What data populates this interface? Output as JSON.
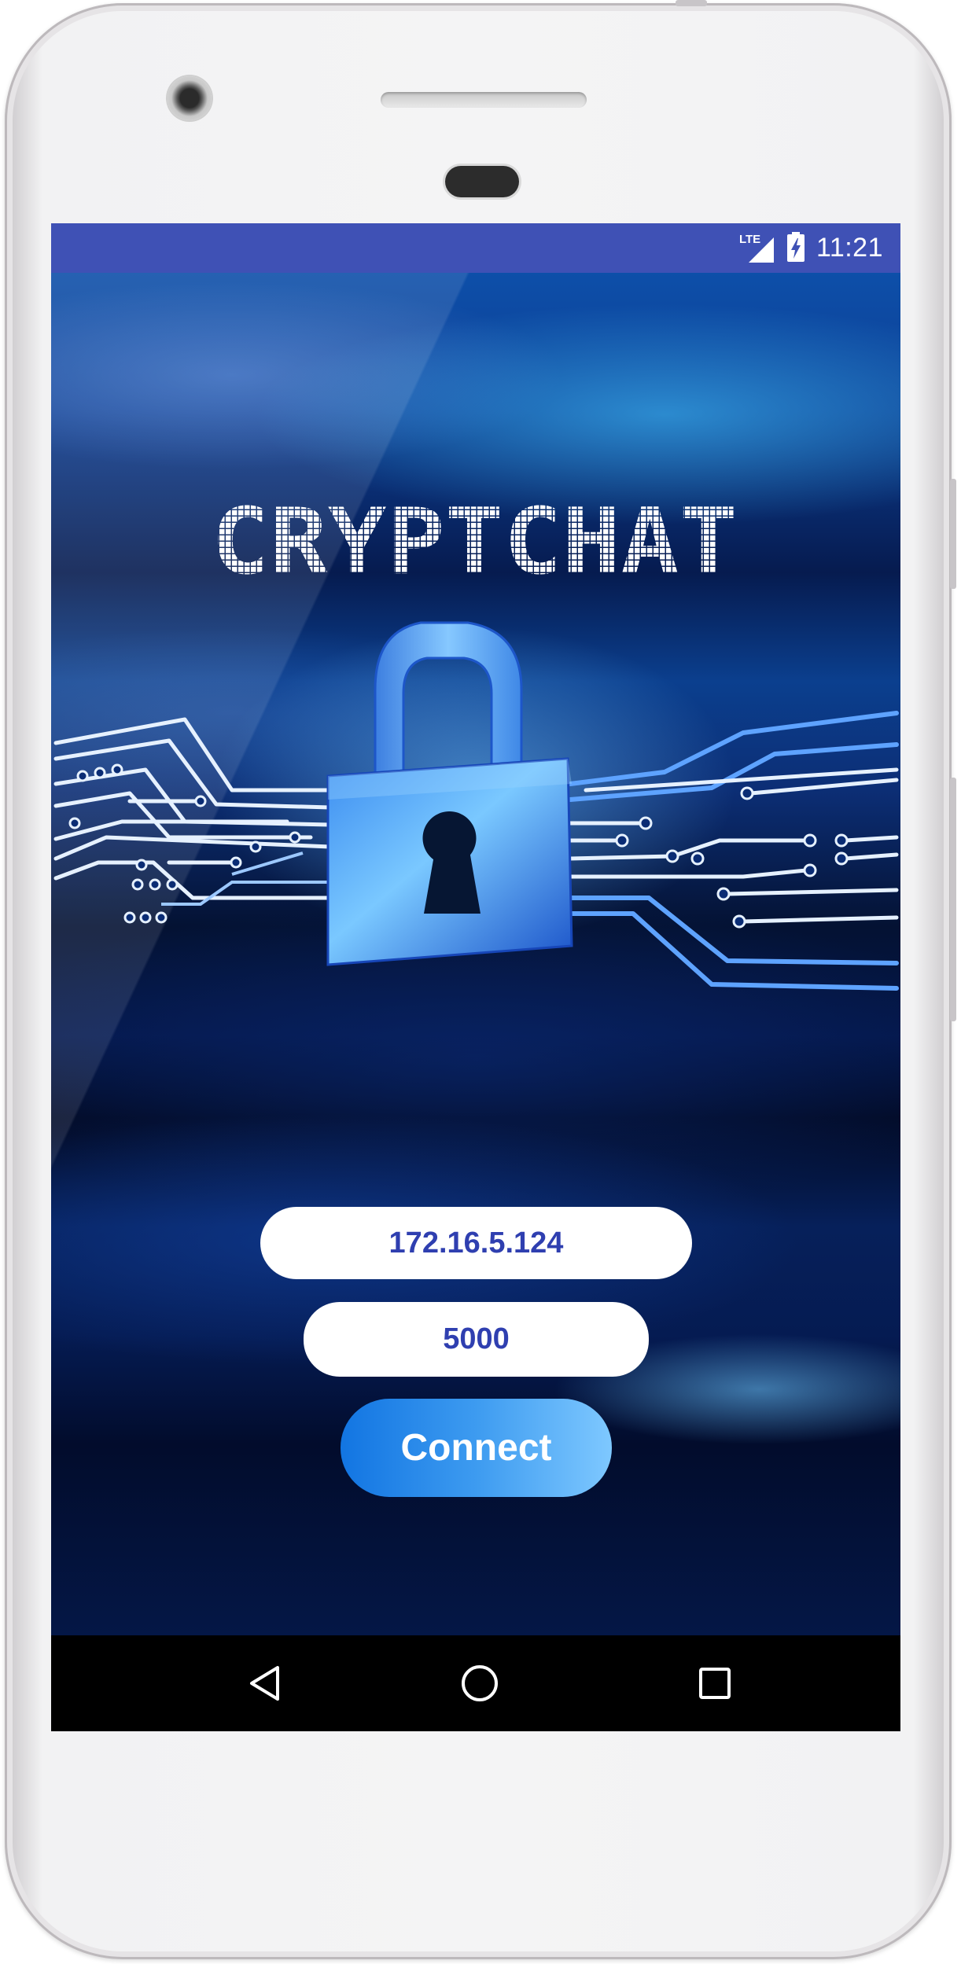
{
  "status_bar": {
    "network_label": "LTE",
    "time": "11:21",
    "icons": [
      "lte-signal-icon",
      "battery-charging-icon"
    ],
    "color": "#3f51b5"
  },
  "app": {
    "title": "CRYPTCHAT",
    "logo_icon": "padlock-circuit-icon",
    "ip_field": {
      "value": "172.16.5.124"
    },
    "port_field": {
      "value": "5000"
    },
    "connect_button": {
      "label": "Connect"
    },
    "accent_color": "#2f3fb0"
  },
  "nav_bar": {
    "buttons": [
      "back-icon",
      "home-icon",
      "recents-icon"
    ]
  }
}
